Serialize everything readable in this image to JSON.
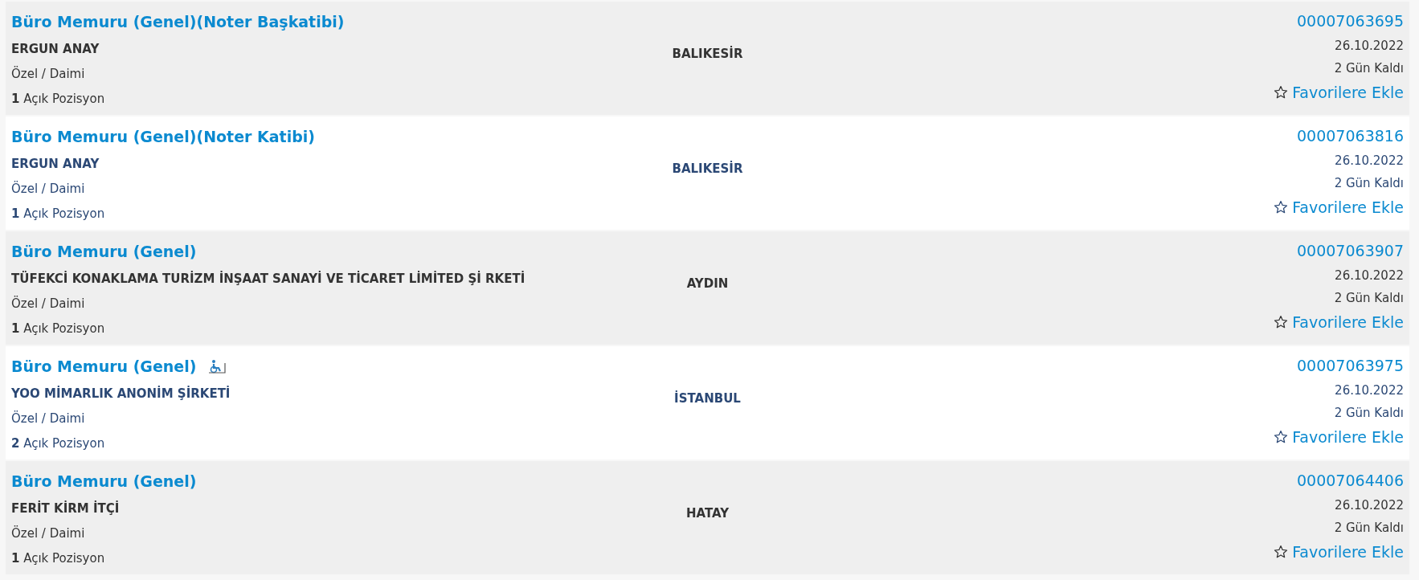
{
  "listings": [
    {
      "title": "Büro Memuru (Genel)(Noter Başkatibi)",
      "accessible": false,
      "shaded": true,
      "employer": "ERGUN ANAY",
      "type": "Özel / Daimi",
      "count": "1",
      "count_label": "Açık Pozisyon",
      "city": "BALIKESİR",
      "number": "00007063695",
      "date": "26.10.2022",
      "remaining": "2 Gün Kaldı",
      "favorite": "Favorilere Ekle"
    },
    {
      "title": "Büro Memuru (Genel)(Noter Katibi)",
      "accessible": false,
      "shaded": false,
      "employer": "ERGUN ANAY",
      "type": "Özel / Daimi",
      "count": "1",
      "count_label": "Açık Pozisyon",
      "city": "BALIKESİR",
      "number": "00007063816",
      "date": "26.10.2022",
      "remaining": "2 Gün Kaldı",
      "favorite": "Favorilere Ekle"
    },
    {
      "title": "Büro Memuru (Genel)",
      "accessible": false,
      "shaded": true,
      "employer": "TÜFEKCİ KONAKLAMA TURİZM İNŞAAT SANAYİ VE TİCARET LİMİTED Şİ RKETİ",
      "type": "Özel / Daimi",
      "count": "1",
      "count_label": "Açık Pozisyon",
      "city": "AYDIN",
      "number": "00007063907",
      "date": "26.10.2022",
      "remaining": "2 Gün Kaldı",
      "favorite": "Favorilere Ekle"
    },
    {
      "title": "Büro Memuru (Genel)",
      "accessible": true,
      "shaded": false,
      "employer": "YOO MİMARLIK ANONİM ŞİRKETİ",
      "type": "Özel / Daimi",
      "count": "2",
      "count_label": "Açık Pozisyon",
      "city": "İSTANBUL",
      "number": "00007063975",
      "date": "26.10.2022",
      "remaining": "2 Gün Kaldı",
      "favorite": "Favorilere Ekle"
    },
    {
      "title": "Büro Memuru (Genel)",
      "accessible": false,
      "shaded": true,
      "employer": "FERİT KİRM İTÇİ",
      "type": "Özel / Daimi",
      "count": "1",
      "count_label": "Açık Pozisyon",
      "city": "HATAY",
      "number": "00007064406",
      "date": "26.10.2022",
      "remaining": "2 Gün Kaldı",
      "favorite": "Favorilere Ekle"
    }
  ]
}
